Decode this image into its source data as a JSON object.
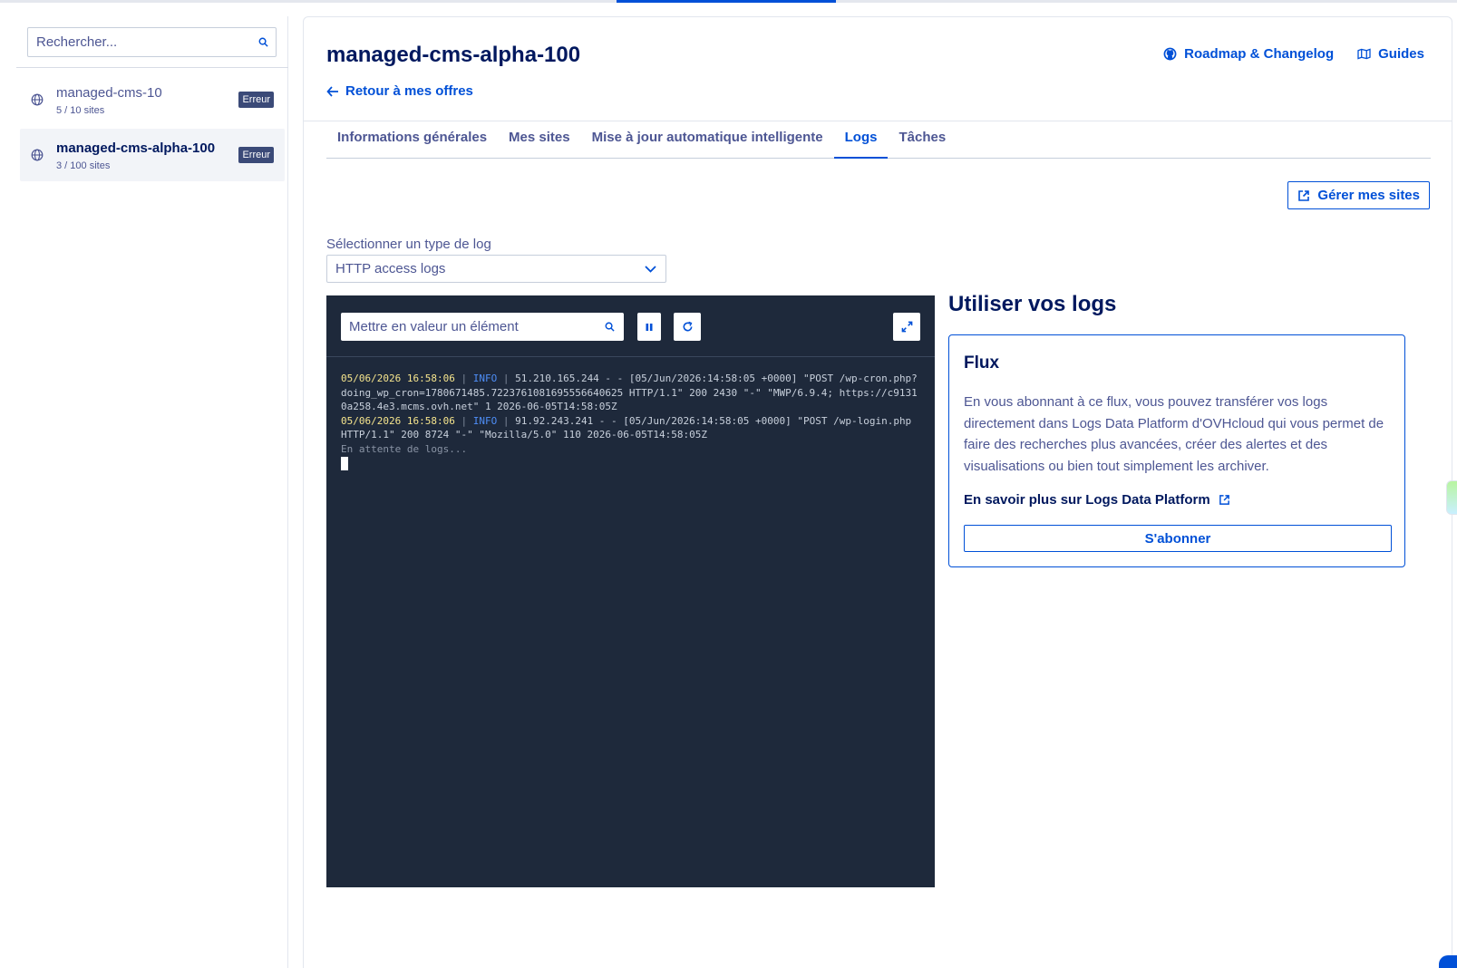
{
  "sidebar": {
    "search_placeholder": "Rechercher...",
    "items": [
      {
        "name": "managed-cms-10",
        "sites": "5 / 10 sites",
        "badge": "Erreur"
      },
      {
        "name": "managed-cms-alpha-100",
        "sites": "3 / 100 sites",
        "badge": "Erreur"
      }
    ]
  },
  "header": {
    "title": "managed-cms-alpha-100",
    "back_label": "Retour à mes offres",
    "roadmap_label": "Roadmap & Changelog",
    "guides_label": "Guides"
  },
  "tabs": [
    {
      "label": "Informations générales"
    },
    {
      "label": "Mes sites"
    },
    {
      "label": "Mise à jour automatique intelligente"
    },
    {
      "label": "Logs"
    },
    {
      "label": "Tâches"
    }
  ],
  "active_tab": "Logs",
  "manage_sites_label": "Gérer mes sites",
  "log_select": {
    "label": "Sélectionner un type de log",
    "value": "HTTP access logs"
  },
  "terminal": {
    "search_placeholder": "Mettre en valeur un élément",
    "lines": [
      {
        "date": "05/06/2026 16:58:06",
        "level": "INFO",
        "message": "51.210.165.244 - - [05/Jun/2026:14:58:05 +0000] \"POST /wp-cron.php?doing_wp_cron=1780671485.7223761081695556640625 HTTP/1.1\" 200 2430 \"-\" \"MWP/6.9.4; https://c91310a258.4e3.mcms.ovh.net\" 1 2026-06-05T14:58:05Z"
      },
      {
        "date": "05/06/2026 16:58:06",
        "level": "INFO",
        "message": "91.92.243.241 - - [05/Jun/2026:14:58:05 +0000] \"POST /wp-login.php HTTP/1.1\" 200 8724 \"-\" \"Mozilla/5.0\" 110 2026-06-05T14:58:05Z"
      }
    ],
    "waiting": "En attente de logs..."
  },
  "usage": {
    "title": "Utiliser vos logs",
    "card": {
      "title": "Flux",
      "description": "En vous abonnant à ce flux, vous pouvez transférer vos logs directement dans Logs Data Platform d'OVHcloud qui vous permet de faire des recherches plus avancées, créer des alertes et des visualisations ou bien tout simplement les archiver.",
      "link": "En savoir plus sur Logs Data Platform",
      "button": "S'abonner"
    }
  },
  "colors": {
    "primary": "#0050d7",
    "heading": "#00185e",
    "text": "#4d5693",
    "terminal_bg": "#1e293b",
    "log_date": "#f6e58d",
    "log_level": "#4e8ef7",
    "badge_bg": "#3b4a78"
  }
}
